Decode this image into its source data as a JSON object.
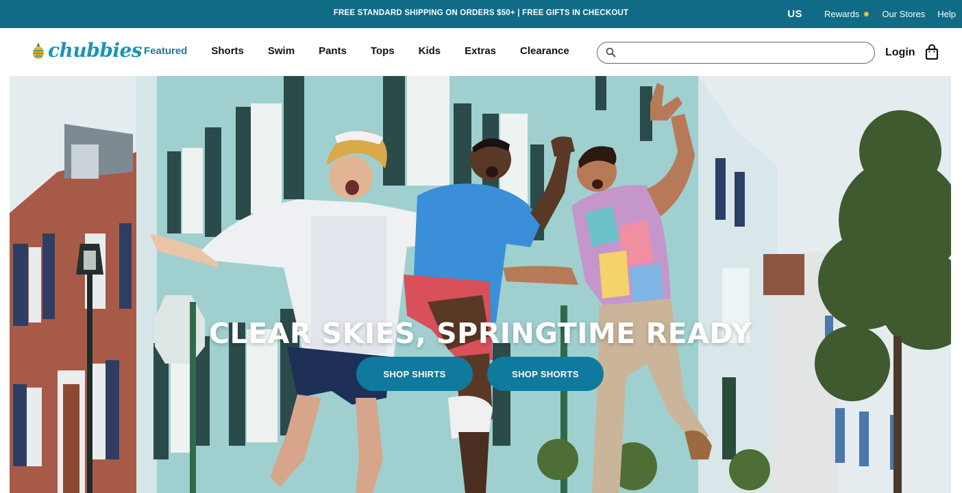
{
  "announcement": {
    "promo_text": "FREE STANDARD SHIPPING ON ORDERS $50+ | FREE GIFTS IN CHECKOUT",
    "region": "US",
    "links": [
      {
        "label": "Rewards",
        "icon": "sun-icon"
      },
      {
        "label": "Our Stores"
      },
      {
        "label": "Help"
      }
    ],
    "background_color": "#0f6b86"
  },
  "header": {
    "logo_text": "chubbies",
    "nav": [
      {
        "label": "Featured",
        "active": true
      },
      {
        "label": "Shorts"
      },
      {
        "label": "Swim"
      },
      {
        "label": "Pants"
      },
      {
        "label": "Tops"
      },
      {
        "label": "Kids"
      },
      {
        "label": "Extras"
      },
      {
        "label": "Clearance"
      }
    ],
    "search": {
      "placeholder": "",
      "value": "",
      "icon": "search-icon"
    },
    "login_label": "Login",
    "bag_icon": "shopping-bag-icon",
    "accent_color": "#1a7d9c"
  },
  "hero": {
    "headline": "CLEAR SKIES, SPRINGTIME READY",
    "buttons": [
      {
        "label": "SHOP SHIRTS"
      },
      {
        "label": "SHOP SHORTS"
      }
    ],
    "button_color": "#0f7a9d",
    "image_description_icon": "hero-photo"
  }
}
